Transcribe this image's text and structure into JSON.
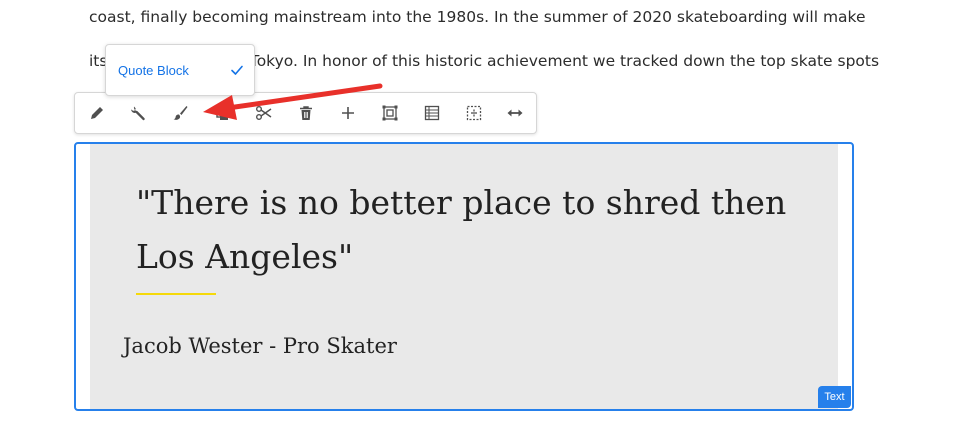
{
  "paragraph": {
    "line1": "coast, finally becoming mainstream into the 1980s. In the summer of 2020 skateboarding will make",
    "line2": "its Olympic debut in Tokyo. In honor of this historic achievement we tracked down the top skate spots"
  },
  "style_dropdown": {
    "selected_label": "Quote Block",
    "checked": true
  },
  "toolbar": {
    "buttons": [
      {
        "name": "edit",
        "icon": "pencil-icon"
      },
      {
        "name": "configure",
        "icon": "wrench-icon"
      },
      {
        "name": "styles",
        "icon": "paintbrush-icon"
      },
      {
        "name": "copy",
        "icon": "copy-icon"
      },
      {
        "name": "cut",
        "icon": "scissors-icon"
      },
      {
        "name": "delete",
        "icon": "trash-icon"
      },
      {
        "name": "insert",
        "icon": "plus-icon"
      },
      {
        "name": "group",
        "icon": "group-icon"
      },
      {
        "name": "layout",
        "icon": "layout-icon"
      },
      {
        "name": "parent",
        "icon": "parent-icon"
      },
      {
        "name": "resize",
        "icon": "resize-arrows-icon"
      }
    ]
  },
  "quote": {
    "text": "\"There is no better place to shred then Los Angeles\"",
    "author": "Jacob Wester - Pro Skater"
  },
  "component_badge": "Text",
  "colors": {
    "accent": "#2680eb",
    "arrow": "#e8302a",
    "quote_background": "#e9e9e9",
    "quote_rule": "#f5d90a"
  }
}
